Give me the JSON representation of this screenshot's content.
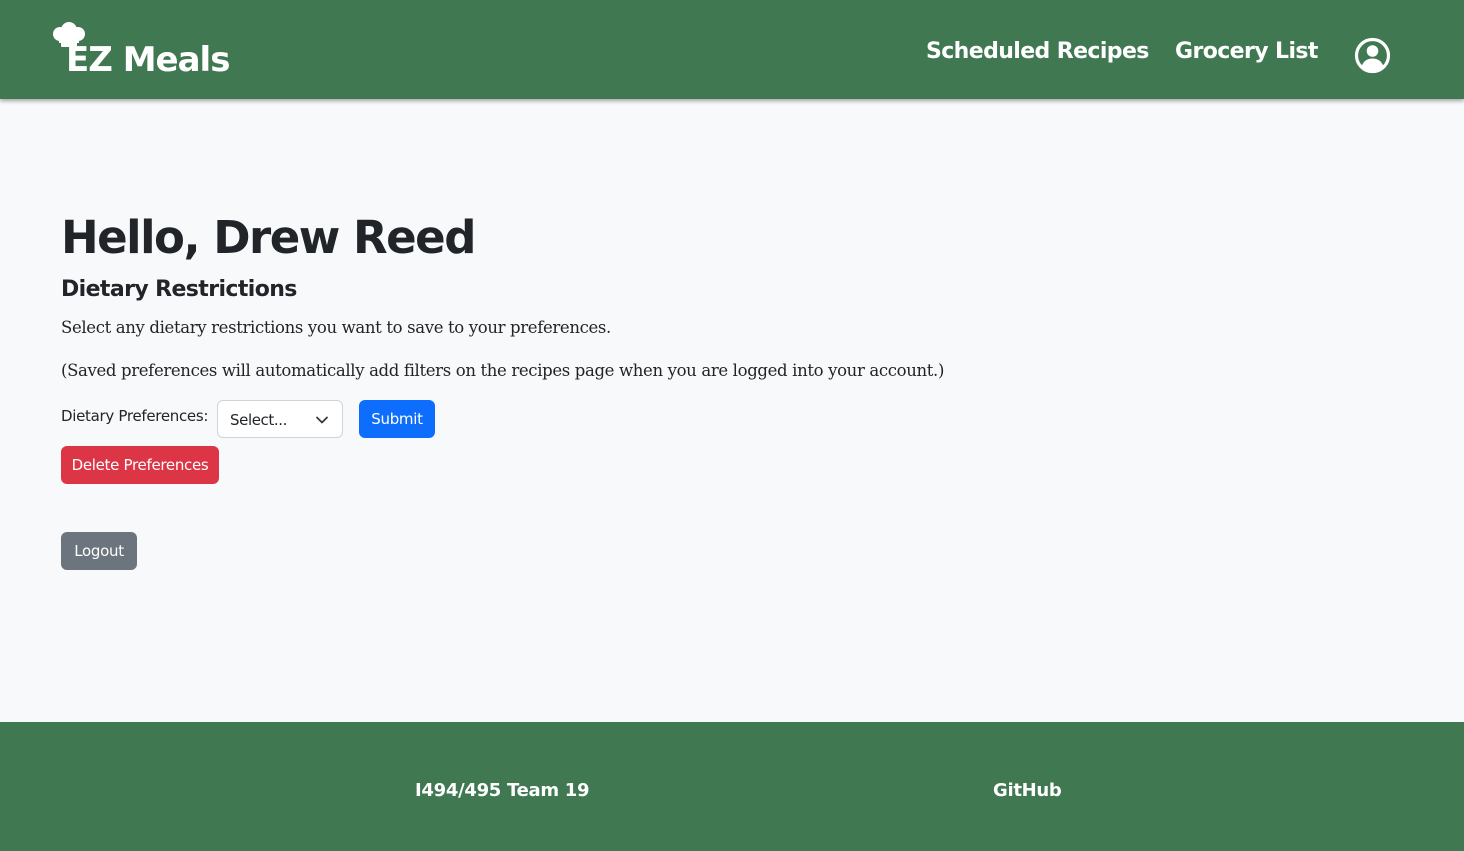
{
  "app": {
    "brand": "EZ Meals"
  },
  "nav": {
    "scheduled_recipes": "Scheduled Recipes",
    "grocery_list": "Grocery List",
    "user_icon": "user-circle-icon"
  },
  "colors": {
    "brand_green": "#407852",
    "page_background": "#f8f9fa",
    "submit_button": "#0d6efd",
    "delete_button": "#dc3545",
    "logout_button": "#6c757d"
  },
  "main": {
    "greeting": "Hello, Drew Reed",
    "section_title": "Dietary Restrictions",
    "description": "Select any dietary restrictions you want to save to your preferences.",
    "note": "(Saved preferences will automatically add filters on the recipes page when you are logged into your account.)",
    "preferences_label": "Dietary Preferences:",
    "select_value": "Select...",
    "submit_label": "Submit",
    "delete_label": "Delete Preferences",
    "logout_label": "Logout"
  },
  "footer": {
    "team": "I494/495 Team 19",
    "github": "GitHub"
  }
}
